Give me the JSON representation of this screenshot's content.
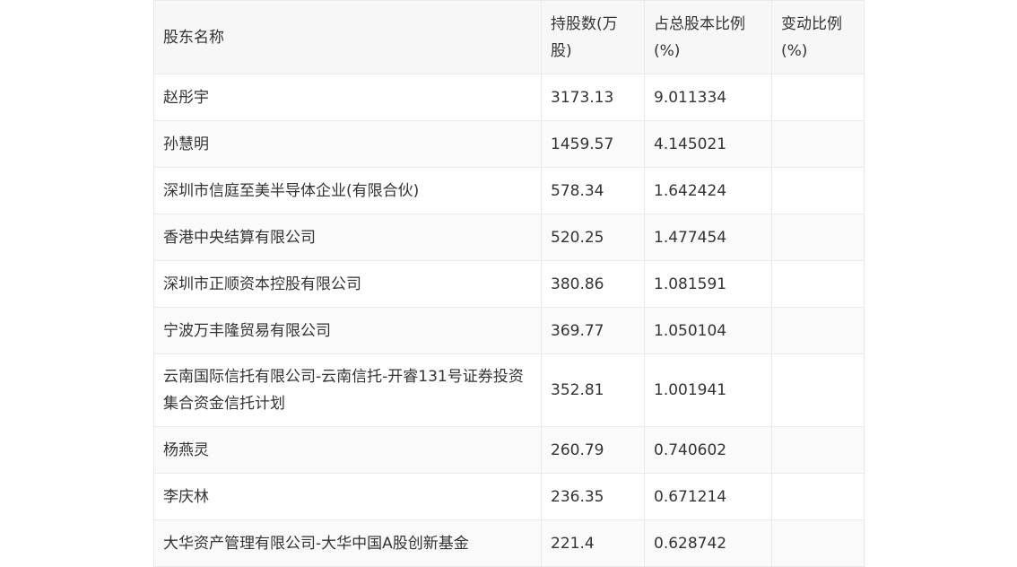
{
  "table": {
    "headers": [
      "股东名称",
      "持股数(万股)",
      "占总股本比例(%)",
      "变动比例(%)"
    ],
    "rows": [
      {
        "name": "赵彤宇",
        "shares": "3173.13",
        "ratio": "9.011334",
        "change": ""
      },
      {
        "name": "孙慧明",
        "shares": "1459.57",
        "ratio": "4.145021",
        "change": ""
      },
      {
        "name": "深圳市信庭至美半导体企业(有限合伙)",
        "shares": "578.34",
        "ratio": "1.642424",
        "change": ""
      },
      {
        "name": "香港中央结算有限公司",
        "shares": "520.25",
        "ratio": "1.477454",
        "change": ""
      },
      {
        "name": "深圳市正顺资本控股有限公司",
        "shares": "380.86",
        "ratio": "1.081591",
        "change": ""
      },
      {
        "name": "宁波万丰隆贸易有限公司",
        "shares": "369.77",
        "ratio": "1.050104",
        "change": ""
      },
      {
        "name": "云南国际信托有限公司-云南信托-开睿131号证券投资集合资金信托计划",
        "shares": "352.81",
        "ratio": "1.001941",
        "change": ""
      },
      {
        "name": "杨燕灵",
        "shares": "260.79",
        "ratio": "0.740602",
        "change": ""
      },
      {
        "name": "李庆林",
        "shares": "236.35",
        "ratio": "0.671214",
        "change": ""
      },
      {
        "name": "大华资产管理有限公司-大华中国A股创新基金",
        "shares": "221.4",
        "ratio": "0.628742",
        "change": ""
      }
    ]
  }
}
